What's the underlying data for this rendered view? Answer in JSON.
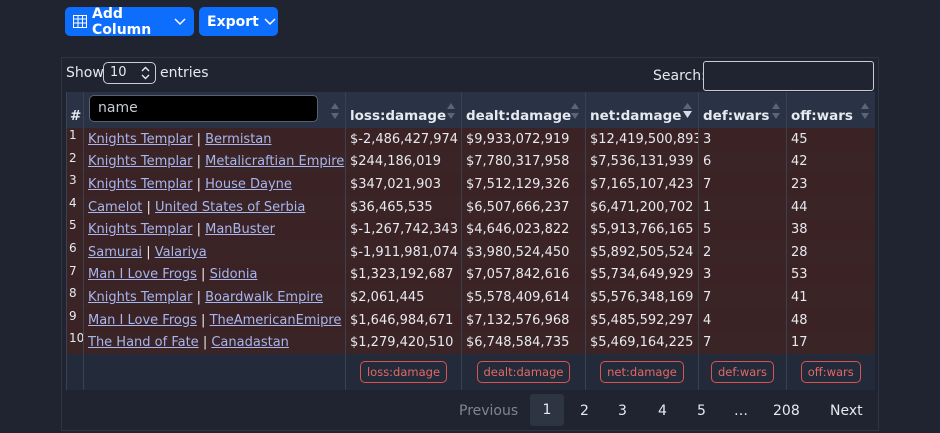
{
  "toolbar": {
    "add_column_label": "Add Column",
    "export_label": "Export"
  },
  "length_menu": {
    "show_label": "Show",
    "selected": "10",
    "entries_label": "entries"
  },
  "search": {
    "label": "Search:",
    "value": ""
  },
  "table": {
    "hash_header": "#",
    "name_filter_placeholder": "name",
    "columns": [
      "loss:damage",
      "dealt:damage",
      "net:damage",
      "def:wars",
      "off:wars"
    ],
    "rows": [
      {
        "idx": "1",
        "a": "Knights Templar",
        "b": "Bermistan",
        "loss": "$-2,486,427,974",
        "dealt": "$9,933,072,919",
        "net": "$12,419,500,893",
        "def": "3",
        "off": "45"
      },
      {
        "idx": "2",
        "a": "Knights Templar",
        "b": "Metalicraftian Empire",
        "loss": "$244,186,019",
        "dealt": "$7,780,317,958",
        "net": "$7,536,131,939",
        "def": "6",
        "off": "42"
      },
      {
        "idx": "3",
        "a": "Knights Templar",
        "b": "House Dayne",
        "loss": "$347,021,903",
        "dealt": "$7,512,129,326",
        "net": "$7,165,107,423",
        "def": "7",
        "off": "23"
      },
      {
        "idx": "4",
        "a": "Camelot",
        "b": "United States of Serbia",
        "loss": "$36,465,535",
        "dealt": "$6,507,666,237",
        "net": "$6,471,200,702",
        "def": "1",
        "off": "44"
      },
      {
        "idx": "5",
        "a": "Knights Templar",
        "b": "ManBuster",
        "loss": "$-1,267,742,343",
        "dealt": "$4,646,023,822",
        "net": "$5,913,766,165",
        "def": "5",
        "off": "38"
      },
      {
        "idx": "6",
        "a": "Samurai",
        "b": "Valariya",
        "loss": "$-1,911,981,074",
        "dealt": "$3,980,524,450",
        "net": "$5,892,505,524",
        "def": "2",
        "off": "28"
      },
      {
        "idx": "7",
        "a": "Man I Love Frogs",
        "b": "Sidonia",
        "loss": "$1,323,192,687",
        "dealt": "$7,057,842,616",
        "net": "$5,734,649,929",
        "def": "3",
        "off": "53"
      },
      {
        "idx": "8",
        "a": "Knights Templar",
        "b": "Boardwalk Empire",
        "loss": "$2,061,445",
        "dealt": "$5,578,409,614",
        "net": "$5,576,348,169",
        "def": "7",
        "off": "41"
      },
      {
        "idx": "9",
        "a": "Man I Love Frogs",
        "b": "TheAmericanEmipre",
        "loss": "$1,646,984,671",
        "dealt": "$7,132,576,968",
        "net": "$5,485,592,297",
        "def": "4",
        "off": "48"
      },
      {
        "idx": "10",
        "a": "The Hand of Fate",
        "b": "Canadastan",
        "loss": "$1,279,420,510",
        "dealt": "$6,748,584,735",
        "net": "$5,469,164,225",
        "def": "7",
        "off": "17"
      }
    ],
    "footer_tags": [
      "loss:damage",
      "dealt:damage",
      "net:damage",
      "def:wars",
      "off:wars"
    ],
    "separator": "|"
  },
  "pagination": {
    "previous": "Previous",
    "pages": [
      "1",
      "2",
      "3",
      "4",
      "5"
    ],
    "current": "1",
    "ellipsis": "…",
    "last": "208",
    "next": "Next"
  },
  "colors": {
    "accent": "#0d6efd",
    "row_bg": "#3b2325",
    "header_bg": "#2a3345",
    "link": "#a7b6ee",
    "tag": "#d9534f"
  }
}
